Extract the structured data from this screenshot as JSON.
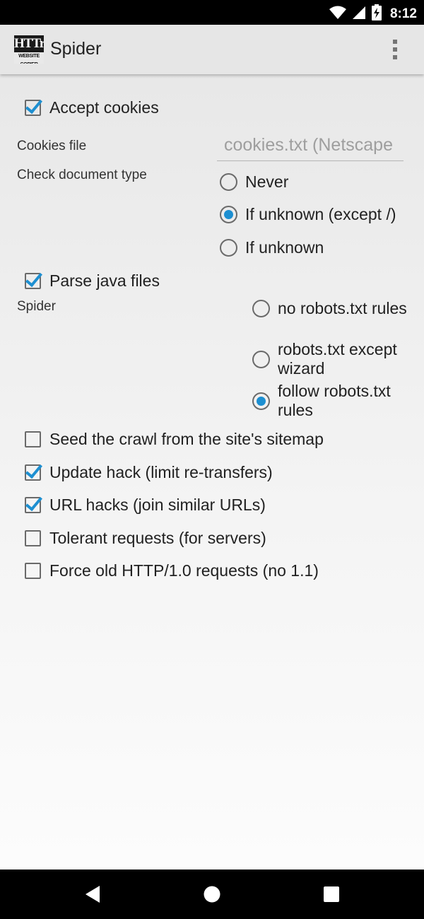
{
  "status_bar": {
    "time": "8:12",
    "icons": [
      "wifi-icon",
      "signal-icon",
      "battery-charging-icon"
    ]
  },
  "app_bar": {
    "title": "Spider",
    "logo_line1": "HTTrack",
    "logo_line2": "WEBSITE COPIER",
    "menu_icon": "overflow-menu-icon"
  },
  "accept_cookies": {
    "label": "Accept cookies",
    "checked": true
  },
  "cookies_file": {
    "label": "Cookies file",
    "value": "cookies.txt (Netscape"
  },
  "check_doc_type": {
    "label": "Check document type",
    "options": [
      {
        "label": "Never",
        "selected": false
      },
      {
        "label": "If unknown (except /)",
        "selected": true
      },
      {
        "label": "If unknown",
        "selected": false
      }
    ]
  },
  "parse_java": {
    "label": "Parse java files",
    "checked": true
  },
  "spider": {
    "label": "Spider",
    "options": [
      {
        "label": "no robots.txt rules",
        "selected": false
      },
      {
        "label": "robots.txt except wizard",
        "selected": false
      },
      {
        "label": "follow robots.txt rules",
        "selected": true
      }
    ]
  },
  "options": [
    {
      "label": "Seed the crawl from the site's sitemap",
      "checked": false
    },
    {
      "label": "Update hack (limit re-transfers)",
      "checked": true
    },
    {
      "label": "URL hacks (join similar URLs)",
      "checked": true
    },
    {
      "label": "Tolerant requests (for servers)",
      "checked": false
    },
    {
      "label": "Force old HTTP/1.0 requests (no 1.1)",
      "checked": false
    }
  ],
  "nav_bar": {
    "buttons": [
      "back-icon",
      "home-icon",
      "recents-icon"
    ]
  },
  "colors": {
    "accent": "#1d8fd1",
    "app_bar": "#e6e6e6",
    "status_bar": "#000000"
  }
}
